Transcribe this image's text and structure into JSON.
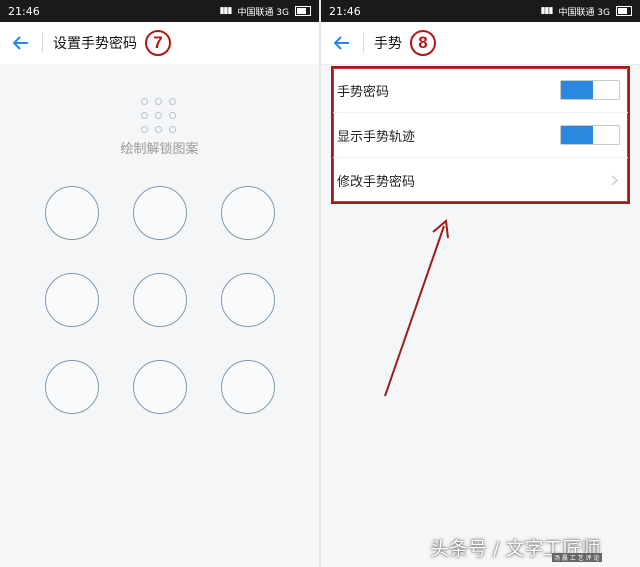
{
  "status": {
    "time_left": "21:46",
    "time_right": "21:46",
    "carrier": "中国联通 3G"
  },
  "left": {
    "title": "设置手势密码",
    "step": "7",
    "hint": "绘制解锁图案"
  },
  "right": {
    "title": "手势",
    "step": "8",
    "rows": [
      {
        "label": "手势密码",
        "toggle": true
      },
      {
        "label": "显示手势轨迹",
        "toggle": true
      },
      {
        "label": "修改手势密码",
        "toggle": false
      }
    ]
  },
  "watermark": {
    "text": "头条号 / 文字工匠师",
    "sub": "汤 晨 工 艺 评 论"
  },
  "colors": {
    "accent": "#2a88e0",
    "annotation": "#a01c1c",
    "pattern_ring": "#7f9bb3"
  },
  "icons": {
    "back": "back-arrow-icon",
    "chevron": "chevron-right-icon"
  }
}
